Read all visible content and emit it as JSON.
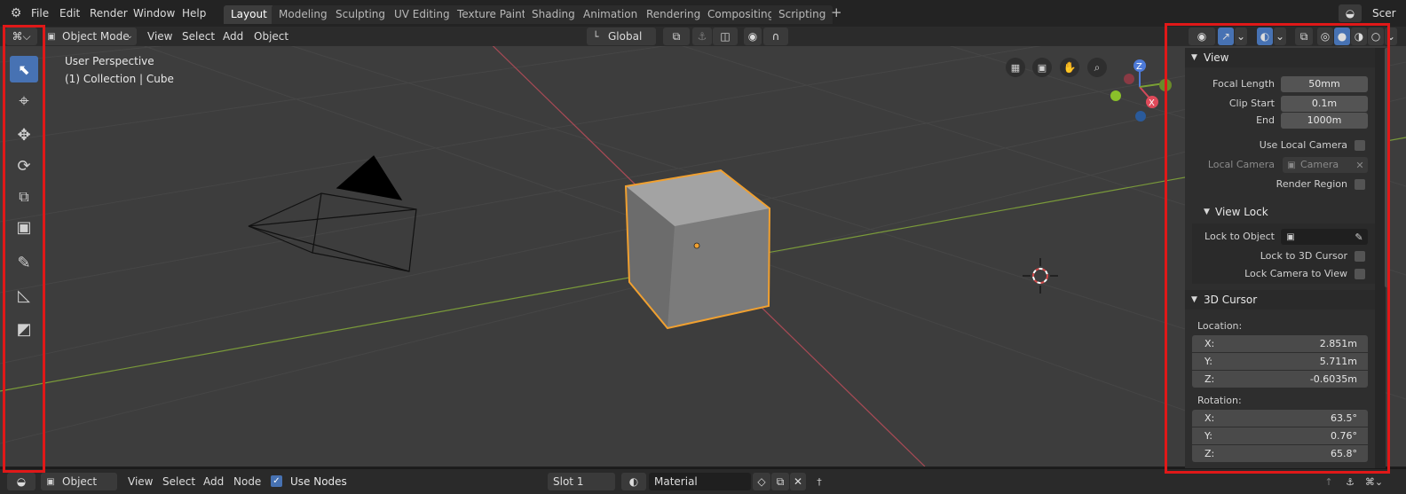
{
  "topbar": {
    "menus": [
      "File",
      "Edit",
      "Render",
      "Window",
      "Help"
    ],
    "workspaces": [
      "Layout",
      "Modeling",
      "Sculpting",
      "UV Editing",
      "Texture Paint",
      "Shading",
      "Animation",
      "Rendering",
      "Compositing",
      "Scripting"
    ],
    "active_workspace": "Layout",
    "add_tab": "+",
    "scene_label": "Scer"
  },
  "viewport_header": {
    "mode": "Object Mode",
    "menus": [
      "View",
      "Select",
      "Add",
      "Object"
    ],
    "transform_orientation": "Global"
  },
  "viewport": {
    "perspective": "User Perspective",
    "collection": "(1) Collection | Cube",
    "gizmo_axes": [
      "Z",
      "X"
    ]
  },
  "sidebar": {
    "view": {
      "title": "View",
      "focal_length_label": "Focal Length",
      "focal_length": "50mm",
      "clip_start_label": "Clip Start",
      "clip_start": "0.1m",
      "end_label": "End",
      "end": "1000m",
      "use_local_camera_label": "Use Local Camera",
      "local_camera_label": "Local Camera",
      "local_camera_value": "Camera",
      "render_region_label": "Render Region"
    },
    "view_lock": {
      "title": "View Lock",
      "lock_to_object_label": "Lock to Object",
      "lock_to_3d_cursor_label": "Lock to 3D Cursor",
      "lock_camera_to_view_label": "Lock Camera to View"
    },
    "cursor": {
      "title": "3D Cursor",
      "location_label": "Location:",
      "loc_x_label": "X:",
      "loc_x": "2.851m",
      "loc_y_label": "Y:",
      "loc_y": "5.711m",
      "loc_z_label": "Z:",
      "loc_z": "-0.6035m",
      "rotation_label": "Rotation:",
      "rot_x_label": "X:",
      "rot_x": "63.5°",
      "rot_y_label": "Y:",
      "rot_y": "0.76°",
      "rot_z_label": "Z:",
      "rot_z": "65.8°"
    }
  },
  "bottombar": {
    "editor_mode": "Object",
    "menus": [
      "View",
      "Select",
      "Add",
      "Node"
    ],
    "use_nodes_label": "Use Nodes",
    "use_nodes_checked": true,
    "slot": "Slot 1",
    "material": "Material"
  },
  "colors": {
    "accent": "#4772b3",
    "selection_outline": "#f0a030",
    "annotation_red": "#e01818",
    "x_axis": "#c94a5a",
    "y_axis": "#8ab332"
  }
}
